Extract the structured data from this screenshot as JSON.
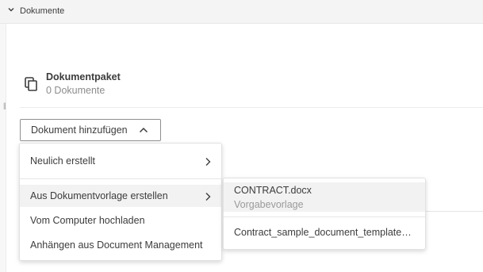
{
  "section": {
    "title": "Dokumente",
    "icon": "chevron-down-icon"
  },
  "package": {
    "icon": "copy-documents-icon",
    "title": "Dokumentpaket",
    "count": "0 Dokumente"
  },
  "add_button": {
    "label": "Dokument hinzufügen",
    "icon": "chevron-up-icon"
  },
  "menu": {
    "items": [
      {
        "label": "Neulich erstellt",
        "has_submenu": true
      },
      {
        "label": "Aus Dokumentvorlage erstellen",
        "has_submenu": true,
        "highlighted": true
      },
      {
        "label": "Vom Computer hochladen",
        "has_submenu": false
      },
      {
        "label": "Anhängen aus Document Management",
        "has_submenu": false
      }
    ]
  },
  "submenu": {
    "items": [
      {
        "name": "CONTRACT.docx",
        "type": "Vorgabevorlage",
        "highlighted": true
      },
      {
        "name": "Contract_sample_document_template_for_Autodesk_Build.docx"
      }
    ]
  },
  "colors": {
    "text": "#3c3c3c",
    "muted": "#8c8c8c",
    "header_bg": "#f4f4f4",
    "hover_bg": "#f2f2f2"
  }
}
